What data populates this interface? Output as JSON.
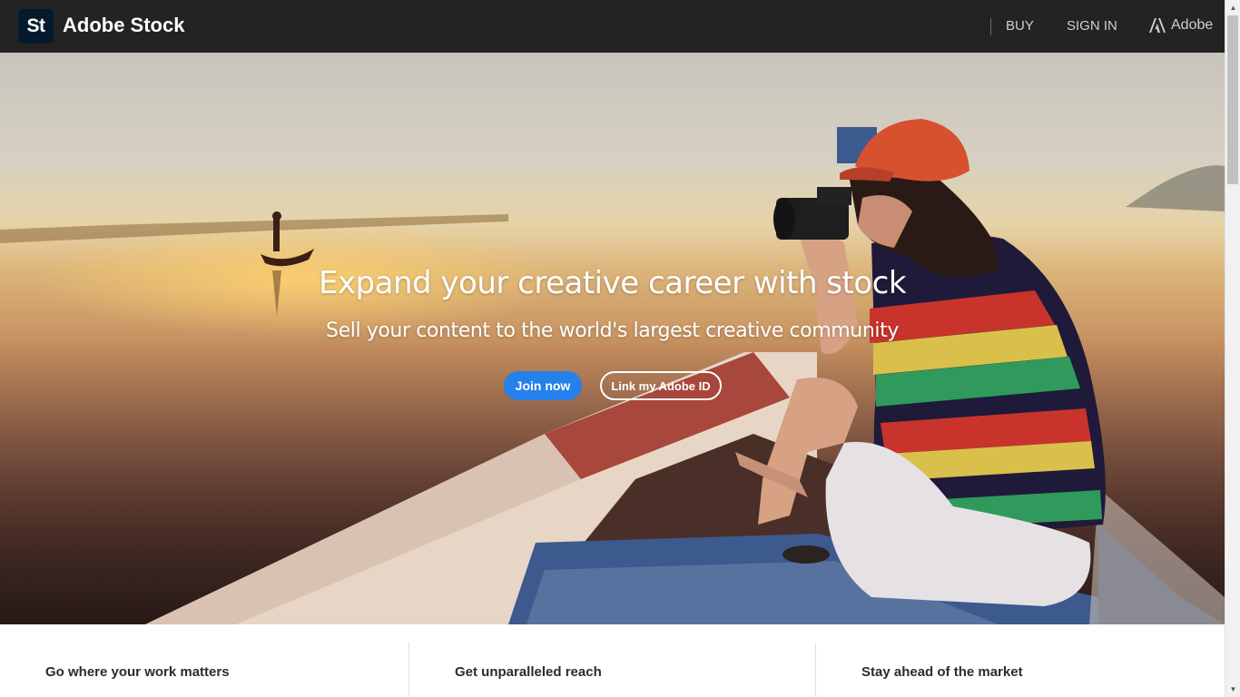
{
  "header": {
    "logo_text": "St",
    "brand": "Adobe Stock",
    "nav": {
      "buy": "BUY",
      "sign_in": "SIGN IN",
      "adobe": "Adobe"
    }
  },
  "hero": {
    "title": "Expand your creative career with stock",
    "subtitle": "Sell your content to the world's largest creative community",
    "join_label": "Join now",
    "link_label": "Link my Adobe ID"
  },
  "features": [
    {
      "title": "Go where your work matters"
    },
    {
      "title": "Get unparalleled reach"
    },
    {
      "title": "Stay ahead of the market"
    }
  ],
  "colors": {
    "topbar": "#232323",
    "logo_badge": "#061a2e",
    "join_button": "#2680eb"
  },
  "icons": {
    "adobe_logo": "adobe-logo-icon"
  }
}
